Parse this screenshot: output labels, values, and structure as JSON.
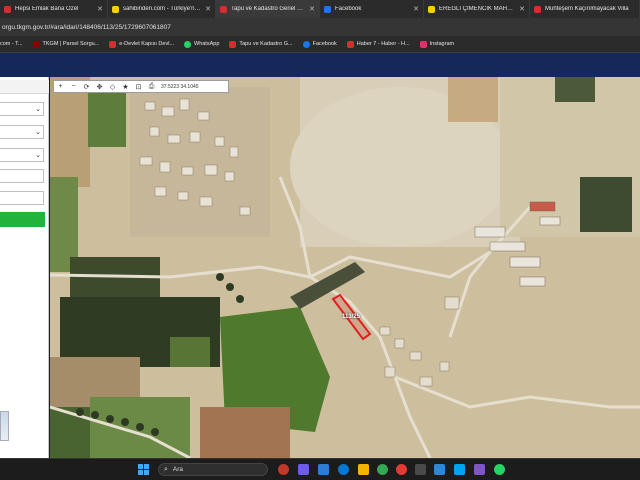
{
  "tabs": [
    {
      "label": "Hepsi Emlak Bana Özel",
      "color": "#d32f2f"
    },
    {
      "label": "sahibinden.com - Türkiye'nin O",
      "color": "#f5d000"
    },
    {
      "label": "Tapu ve Kadastro Genel Müdürl",
      "color": "#d32f2f"
    },
    {
      "label": "Facebook",
      "color": "#1877f2"
    },
    {
      "label": "EREĞLİ ÇİMENCİK MAHALLESİN",
      "color": "#f5d000"
    },
    {
      "label": "Muhteşem Kaçırılmayacak Villa",
      "color": "#d32f2f"
    }
  ],
  "address": {
    "url": "orgu.tkgm.gov.tr/#ara/idari/148406/113/25/1729607061807"
  },
  "bookmarks": [
    {
      "label": "com - T...",
      "color": "#ffffff"
    },
    {
      "label": "TKGM | Parsel Sorgu...",
      "color": "#8b0000"
    },
    {
      "label": "e-Devlet Kapısı Devl...",
      "color": "#d32f2f"
    },
    {
      "label": "WhatsApp",
      "color": "#25d366"
    },
    {
      "label": "Tapu ve Kadastro G...",
      "color": "#d32f2f"
    },
    {
      "label": "Facebook",
      "color": "#1877f2"
    },
    {
      "label": "Haber 7 - Haber - H...",
      "color": "#d32f2f"
    },
    {
      "label": "Instagram",
      "color": "#e1306c"
    }
  ],
  "map": {
    "coords": "37.5223 34.1045",
    "parcel_label": "113/25",
    "tools": [
      "+",
      "−",
      "⟳",
      "✥",
      "◇",
      "★",
      "⊡",
      "⎙"
    ]
  },
  "taskbar": {
    "search_text": "Ara",
    "search_icon": "search-icon"
  },
  "colors": {
    "site_header": "#14295a",
    "query_button": "#21b33b",
    "parcel_outline": "#e02020"
  }
}
